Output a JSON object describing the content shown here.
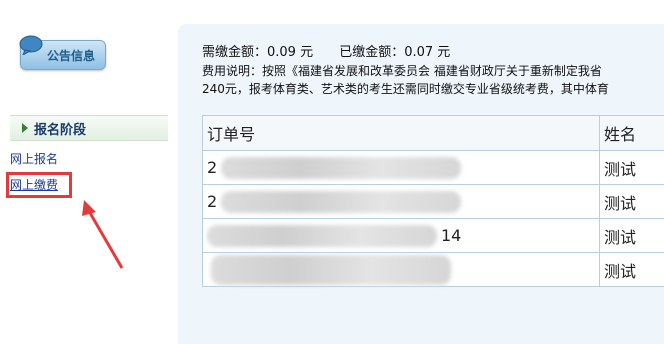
{
  "sidebar": {
    "notice_button_label": "公告信息",
    "stage_title": "报名阶段",
    "links": [
      "网上报名",
      "网上缴费"
    ]
  },
  "fee_info": {
    "due_label": "需缴金额：0.09  元",
    "paid_label": "已缴金额：0.07  元",
    "desc_line1": "费用说明：按照《福建省发展和改革委员会 福建省财政厅关于重新制定我省",
    "desc_line2": "240元，报考体育类、艺术类的考生还需同时缴交专业省级统考费，其中体育"
  },
  "orders_table": {
    "headers": [
      "订单号",
      "姓名"
    ],
    "rows": [
      {
        "order_visible": "2",
        "name": "测试"
      },
      {
        "order_visible": "2",
        "name": "测试"
      },
      {
        "order_visible": "14",
        "name": "测试"
      },
      {
        "order_visible": "",
        "name": "测试"
      }
    ]
  },
  "colors": {
    "panel_bg": "#eef6fc",
    "highlight": "#e33b3b",
    "link": "#1a3b9a"
  }
}
